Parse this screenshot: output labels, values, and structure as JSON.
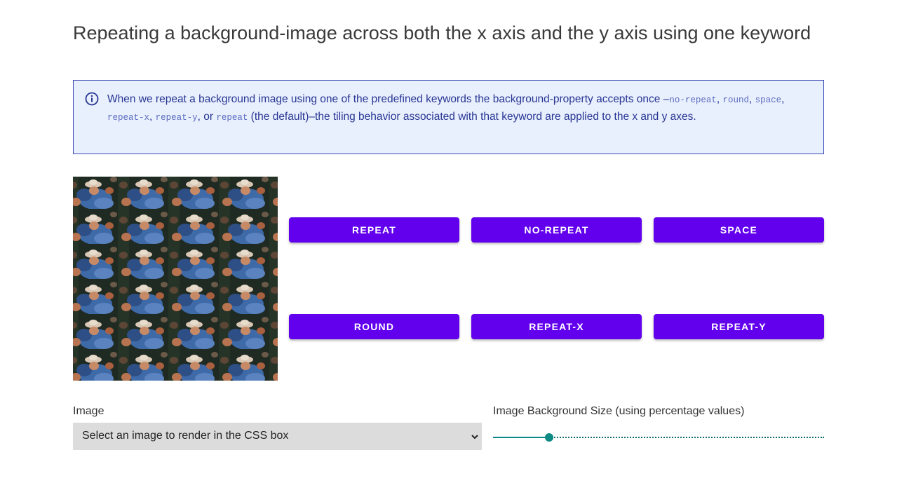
{
  "heading": "Repeating a background-image across both the x axis and the y axis using one keyword",
  "note": {
    "icon": "info-icon",
    "intro": "When we repeat a background image using one of the predefined keywords the background-property accepts once –",
    "kw_no_repeat": "no-repeat",
    "kw_round": "round",
    "kw_space": "space",
    "kw_repeat_x": "repeat-x",
    "kw_repeat_y": "repeat-y",
    "kw_repeat": "repeat",
    "sep": ", ",
    "or": ", or ",
    "outro": " (the default)–the tiling behavior associated with that keyword are applied to the x and y axes."
  },
  "buttons": {
    "repeat": "REPEAT",
    "no_repeat": "NO-REPEAT",
    "space": "SPACE",
    "round": "ROUND",
    "repeat_x": "REPEAT-X",
    "repeat_y": "REPEAT-Y"
  },
  "image_field": {
    "label": "Image",
    "selected": "Select an image to render in the CSS box",
    "icon": "chevron-down-icon"
  },
  "size_field": {
    "label": "Image Background Size (using percentage values)",
    "value_fraction": 0.17
  },
  "colors": {
    "button": "#6200ee",
    "note_background": "#e8f0fd",
    "note_border": "#3b48b5",
    "slider": "#0d8a84"
  }
}
